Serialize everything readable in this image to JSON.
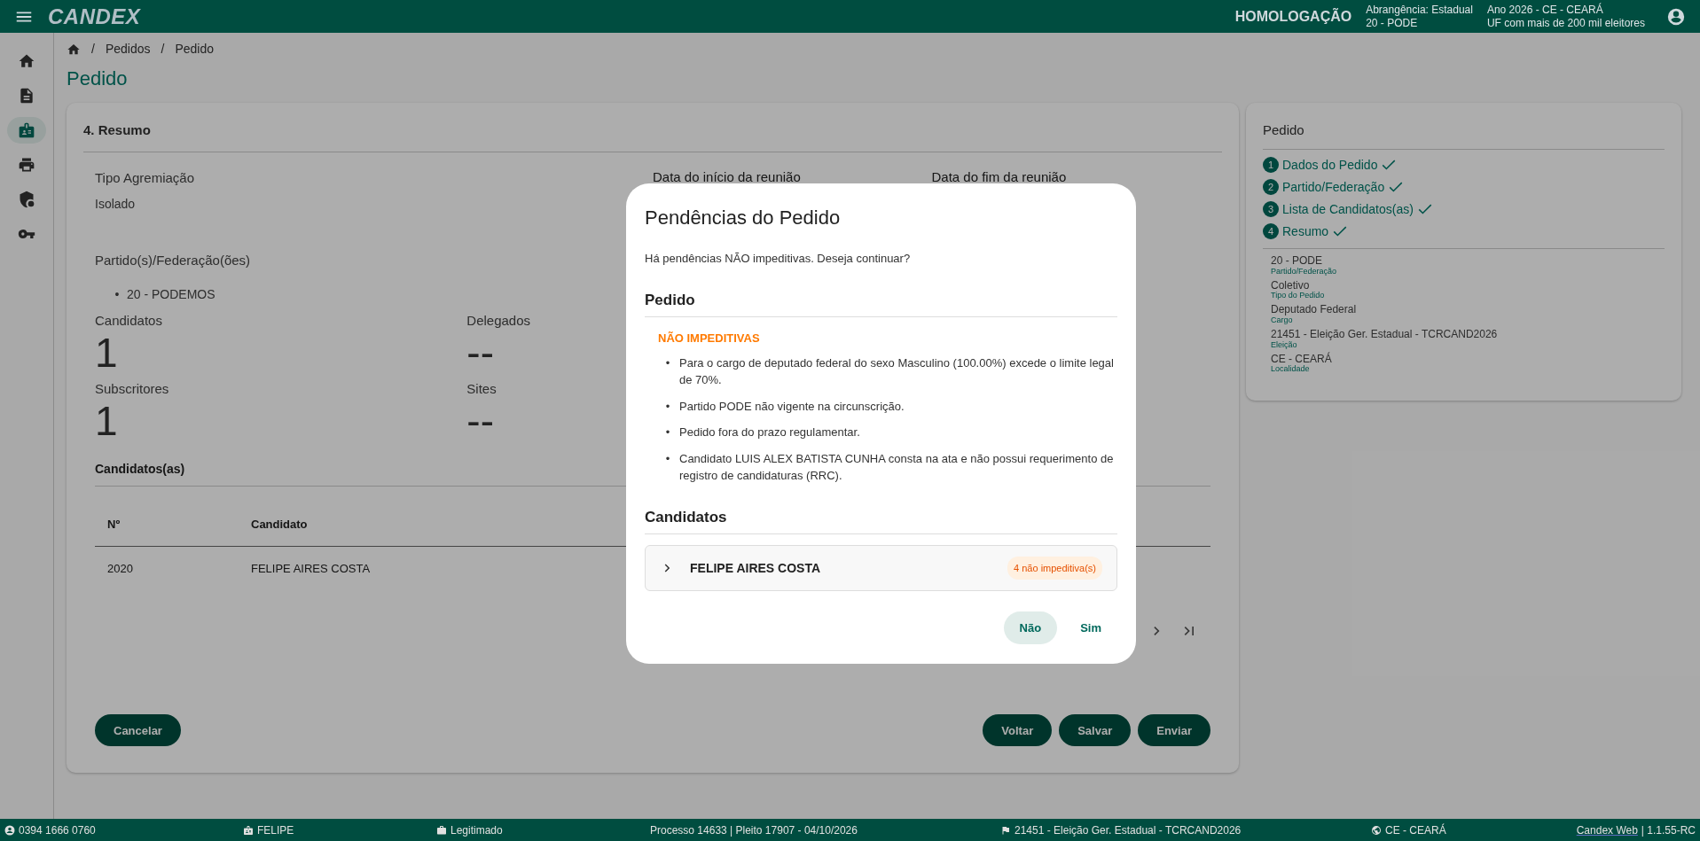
{
  "topbar": {
    "logo": "CANDEX",
    "environment": "HOMOLOGAÇÃO",
    "scope_lines": [
      "Abrangência: Estadual",
      "20 - PODE"
    ],
    "election_lines": [
      "Ano 2026 - CE - CEARÁ",
      "UF com mais de 200 mil eleitores"
    ]
  },
  "sidebar": {
    "items": [
      {
        "kind": "home",
        "selected": false
      },
      {
        "kind": "document",
        "selected": false
      },
      {
        "kind": "badge",
        "selected": true
      },
      {
        "kind": "printer",
        "selected": false
      },
      {
        "kind": "shield",
        "selected": false
      },
      {
        "kind": "key",
        "selected": false
      }
    ]
  },
  "breadcrumb": {
    "separator": "/",
    "items": [
      "Pedidos",
      "Pedido"
    ]
  },
  "bullet": "•",
  "page_title": "Pedido",
  "summary": {
    "title": "4. Resumo",
    "fields": [
      {
        "label": "Tipo Agremiação",
        "value": "Isolado"
      },
      {
        "label": "Data do início da reunião"
      },
      {
        "label": "Data do fim da reunião"
      }
    ],
    "parties_label": "Partido(s)/Federação(ões)",
    "parties": [
      "20 - PODEMOS"
    ],
    "stats": [
      {
        "label": "Candidatos",
        "value": "1"
      },
      {
        "label": "Delegados",
        "value": "--"
      },
      {
        "label": "Subscritores",
        "value": "1"
      },
      {
        "label": "Sites",
        "value": "--"
      }
    ],
    "candidates_title": "Candidatos(as)",
    "table": {
      "columns": [
        "Nº",
        "Candidato"
      ],
      "rows": [
        [
          "2020",
          "FELIPE AIRES COSTA"
        ]
      ]
    },
    "cancel_button": "Cancelar",
    "actions": [
      "Voltar",
      "Salvar",
      "Enviar"
    ]
  },
  "steps_card": {
    "title": "Pedido",
    "steps": [
      {
        "number": "1",
        "label": "Dados do Pedido",
        "done": true
      },
      {
        "number": "2",
        "label": "Partido/Federação",
        "done": true
      },
      {
        "number": "3",
        "label": "Lista de Candidatos(as)",
        "done": true
      },
      {
        "number": "4",
        "label": "Resumo",
        "done": true
      }
    ],
    "info": [
      {
        "value": "20 - PODE",
        "label": "Partido/Federação"
      },
      {
        "value": "Coletivo",
        "label": "Tipo do Pedido"
      },
      {
        "value": "Deputado Federal",
        "label": "Cargo"
      },
      {
        "value": "21451 - Eleição Ger. Estadual - TCRCAND2026",
        "label": "Eleição"
      },
      {
        "value": "CE - CEARÁ",
        "label": "Localidade"
      }
    ]
  },
  "dialog": {
    "title": "Pendências do Pedido",
    "message": "Há pendências NÃO impeditivas. Deseja continuar?",
    "order_section": {
      "title": "Pedido",
      "group_title": "NÃO IMPEDITIVAS",
      "items": [
        "Para o cargo de deputado federal do sexo Masculino (100.00%) excede o limite legal de 70%.",
        "Partido PODE não vigente na circunscrição.",
        "Pedido fora do prazo regulamentar.",
        "Candidato LUIS ALEX BATISTA CUNHA consta na ata e não possui requerimento de registro de candidaturas (RRC)."
      ]
    },
    "candidates_section": {
      "title": "Candidatos",
      "items": [
        {
          "name": "FELIPE AIRES COSTA",
          "badge": "4 não impeditiva(s)",
          "expanded": false
        }
      ]
    },
    "buttons": [
      {
        "label": "Não",
        "kind": "tonal"
      },
      {
        "label": "Sim",
        "kind": "text"
      }
    ]
  },
  "status_bar": [
    {
      "kind": "person",
      "text": "0394 1666 0760"
    },
    {
      "kind": "badge",
      "text": "FELIPE"
    },
    {
      "kind": "briefcase",
      "text": "Legitimado"
    },
    {
      "kind": "plain",
      "text": "Processo 14633 | Pleito 17907 - 04/10/2026"
    },
    {
      "kind": "flag",
      "text": "21451 - Eleição Ger. Estadual - TCRCAND2026"
    },
    {
      "kind": "globe",
      "text": "CE - CEARÁ"
    },
    {
      "kind": "version",
      "link": "Candex Web",
      "text": "| 1.1.55-RC"
    }
  ]
}
